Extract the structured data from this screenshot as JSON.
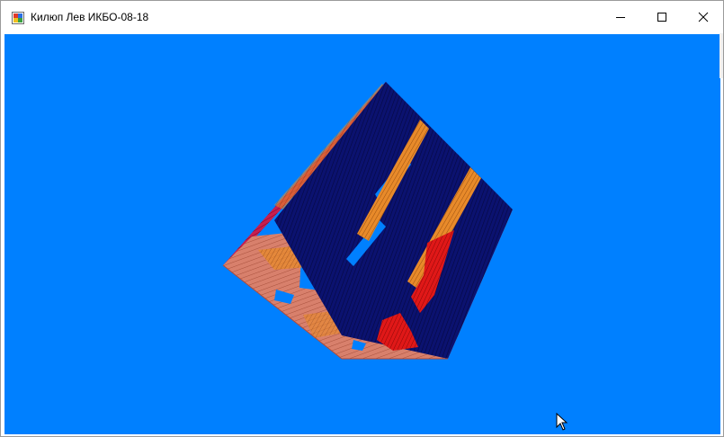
{
  "window": {
    "title": "Килюп Лев ИКБО-08-18",
    "icon": "app-window-icon"
  },
  "caption_buttons": {
    "minimize": "minimize-icon",
    "maximize": "maximize-icon",
    "close": "close-icon"
  },
  "viewport": {
    "background_color": "#0080ff",
    "scene": "rotating textured cube",
    "face_colors": {
      "top_face": "#0a0f6e",
      "front_face": "#d47a6a",
      "left_face": "#c81e50",
      "stripe_accent": "#e88a2a",
      "red_accent": "#e01010"
    }
  },
  "cursor": "mouse-pointer-icon"
}
